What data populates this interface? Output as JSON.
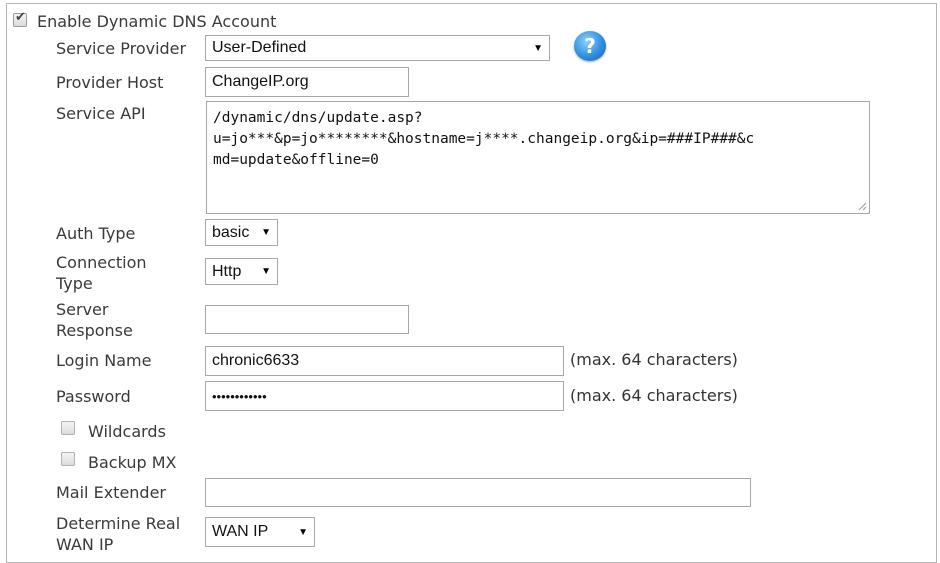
{
  "enable_ddns": {
    "label": "Enable Dynamic DNS Account",
    "checked": true
  },
  "service_provider": {
    "label": "Service Provider",
    "value": "User-Defined"
  },
  "provider_host": {
    "label": "Provider Host",
    "value": "ChangeIP.org"
  },
  "service_api": {
    "label": "Service API",
    "line1": "/dynamic/dns/update.asp?",
    "line2": "u=jo***&p=jo********&hostname=j****.changeip.org&ip=###IP###&c",
    "line3": "md=update&offline=0"
  },
  "auth_type": {
    "label": "Auth Type",
    "value": "basic"
  },
  "connection_type": {
    "label_line1": "Connection",
    "label_line2": "Type",
    "value": "Http"
  },
  "server_response": {
    "label_line1": "Server",
    "label_line2": "Response",
    "value": ""
  },
  "login_name": {
    "label": "Login Name",
    "value": "chronic6633",
    "hint": "(max. 64 characters)"
  },
  "password": {
    "label": "Password",
    "value": "••••••••••••",
    "hint": "(max. 64 characters)"
  },
  "wildcards": {
    "label": "Wildcards",
    "checked": false
  },
  "backup_mx": {
    "label": "Backup MX",
    "checked": false
  },
  "mail_extender": {
    "label": "Mail Extender",
    "value": ""
  },
  "determine_wan_ip": {
    "label_line1": "Determine Real",
    "label_line2": "WAN IP",
    "value": "WAN IP"
  },
  "icons": {
    "help": "help-icon"
  },
  "colors": {
    "border": "#a7a7a7",
    "help_blue": "#2e8fe0"
  }
}
